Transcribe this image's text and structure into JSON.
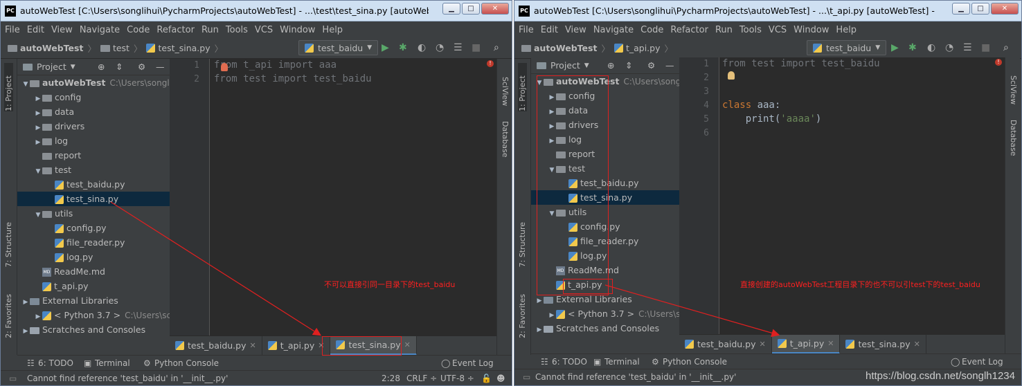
{
  "left": {
    "title": "autoWebTest [C:\\Users\\songlihui\\PycharmProjects\\autoWebTest] - ...\\test\\test_sina.py [autoWebTest] - ...",
    "menu": [
      "File",
      "Edit",
      "View",
      "Navigate",
      "Code",
      "Refactor",
      "Run",
      "Tools",
      "VCS",
      "Window",
      "Help"
    ],
    "breadcrumb": [
      "autoWebTest",
      "test",
      "test_sina.py"
    ],
    "run_config": "test_baidu",
    "project_header": "Project",
    "tree": [
      {
        "label": "autoWebTest",
        "path": "C:\\Users\\songli",
        "depth": 0,
        "arrow": "▼",
        "type": "folder",
        "bold": true
      },
      {
        "label": "config",
        "depth": 1,
        "arrow": "▶",
        "type": "folder"
      },
      {
        "label": "data",
        "depth": 1,
        "arrow": "▶",
        "type": "folder"
      },
      {
        "label": "drivers",
        "depth": 1,
        "arrow": "▶",
        "type": "folder"
      },
      {
        "label": "log",
        "depth": 1,
        "arrow": "▶",
        "type": "folder"
      },
      {
        "label": "report",
        "depth": 1,
        "arrow": "",
        "type": "folder"
      },
      {
        "label": "test",
        "depth": 1,
        "arrow": "▼",
        "type": "folder"
      },
      {
        "label": "test_baidu.py",
        "depth": 2,
        "arrow": "",
        "type": "py"
      },
      {
        "label": "test_sina.py",
        "depth": 2,
        "arrow": "",
        "type": "py",
        "selected": true
      },
      {
        "label": "utils",
        "depth": 1,
        "arrow": "▼",
        "type": "folder"
      },
      {
        "label": "config.py",
        "depth": 2,
        "arrow": "",
        "type": "py"
      },
      {
        "label": "file_reader.py",
        "depth": 2,
        "arrow": "",
        "type": "py"
      },
      {
        "label": "log.py",
        "depth": 2,
        "arrow": "",
        "type": "py"
      },
      {
        "label": "ReadMe.md",
        "depth": 1,
        "arrow": "",
        "type": "md"
      },
      {
        "label": "t_api.py",
        "depth": 1,
        "arrow": "",
        "type": "py"
      },
      {
        "label": "External Libraries",
        "depth": 0,
        "arrow": "▶",
        "type": "lib"
      },
      {
        "label": "< Python 3.7 >",
        "path": "C:\\Users\\sc",
        "depth": 1,
        "arrow": "▶",
        "type": "python"
      },
      {
        "label": "Scratches and Consoles",
        "depth": 0,
        "arrow": "▶",
        "type": "scratch"
      }
    ],
    "code_lines": [
      [
        {
          "t": "from ",
          "c": "dim"
        },
        {
          "t": "t_api ",
          "c": "dim"
        },
        {
          "t": "import ",
          "c": "dim"
        },
        {
          "t": "aaa",
          "c": "dim"
        }
      ],
      [
        {
          "t": "from ",
          "c": "dim"
        },
        {
          "t": "test ",
          "c": "dim"
        },
        {
          "t": "import ",
          "c": "dim"
        },
        {
          "t": "test_baidu",
          "c": "dim"
        }
      ]
    ],
    "line_numbers": [
      "1",
      "2"
    ],
    "tabs": [
      {
        "label": "test_baidu.py",
        "active": false
      },
      {
        "label": "t_api.py",
        "active": false
      },
      {
        "label": "test_sina.py",
        "active": true
      }
    ],
    "side_left": [
      "1: Project",
      "7: Structure",
      "2: Favorites"
    ],
    "side_right": [
      "SciView",
      "Database"
    ],
    "bottom_tools": [
      "6: TODO",
      "Terminal",
      "Python Console"
    ],
    "event_log": "Event Log",
    "status_msg": "Cannot find reference 'test_baidu' in '__init__.py'",
    "status_pos": "2:28",
    "status_crlf": "CRLF ÷",
    "status_enc": "UTF-8 ÷",
    "annotation": "不可以直接引同一目录下的test_baidu"
  },
  "right": {
    "title": "autoWebTest [C:\\Users\\songlihui\\PycharmProjects\\autoWebTest] - ...\\t_api.py [autoWebTest] - PyChar...",
    "menu": [
      "File",
      "Edit",
      "View",
      "Navigate",
      "Code",
      "Refactor",
      "Run",
      "Tools",
      "VCS",
      "Window",
      "Help"
    ],
    "breadcrumb": [
      "autoWebTest",
      "t_api.py"
    ],
    "run_config": "test_baidu",
    "project_header": "Project",
    "tree": [
      {
        "label": "autoWebTest",
        "path": "C:\\Users\\songli",
        "depth": 0,
        "arrow": "▼",
        "type": "folder",
        "bold": true
      },
      {
        "label": "config",
        "depth": 1,
        "arrow": "▶",
        "type": "folder"
      },
      {
        "label": "data",
        "depth": 1,
        "arrow": "▶",
        "type": "folder"
      },
      {
        "label": "drivers",
        "depth": 1,
        "arrow": "▶",
        "type": "folder"
      },
      {
        "label": "log",
        "depth": 1,
        "arrow": "▶",
        "type": "folder"
      },
      {
        "label": "report",
        "depth": 1,
        "arrow": "",
        "type": "folder"
      },
      {
        "label": "test",
        "depth": 1,
        "arrow": "▼",
        "type": "folder"
      },
      {
        "label": "test_baidu.py",
        "depth": 2,
        "arrow": "",
        "type": "py"
      },
      {
        "label": "test_sina.py",
        "depth": 2,
        "arrow": "",
        "type": "py",
        "selected": true
      },
      {
        "label": "utils",
        "depth": 1,
        "arrow": "▼",
        "type": "folder"
      },
      {
        "label": "config.py",
        "depth": 2,
        "arrow": "",
        "type": "py"
      },
      {
        "label": "file_reader.py",
        "depth": 2,
        "arrow": "",
        "type": "py"
      },
      {
        "label": "log.py",
        "depth": 2,
        "arrow": "",
        "type": "py"
      },
      {
        "label": "ReadMe.md",
        "depth": 1,
        "arrow": "",
        "type": "md"
      },
      {
        "label": "t_api.py",
        "depth": 1,
        "arrow": "",
        "type": "py"
      },
      {
        "label": "External Libraries",
        "depth": 0,
        "arrow": "▶",
        "type": "lib"
      },
      {
        "label": "< Python 3.7 >",
        "path": "C:\\Users\\sc",
        "depth": 1,
        "arrow": "▶",
        "type": "python"
      },
      {
        "label": "Scratches and Consoles",
        "depth": 0,
        "arrow": "▶",
        "type": "scratch"
      }
    ],
    "code_lines": [
      [
        {
          "t": "from ",
          "c": "dim"
        },
        {
          "t": "test ",
          "c": "dim"
        },
        {
          "t": "import ",
          "c": "dim"
        },
        {
          "t": "test_baidu",
          "c": "dim"
        }
      ],
      [],
      [],
      [
        {
          "t": "class ",
          "c": "kw"
        },
        {
          "t": "aaa:",
          "c": ""
        }
      ],
      [
        {
          "t": "    ",
          "c": ""
        },
        {
          "t": "print(",
          "c": ""
        },
        {
          "t": "'aaaa'",
          "c": "str"
        },
        {
          "t": ")",
          "c": ""
        }
      ],
      []
    ],
    "line_numbers": [
      "1",
      "2",
      "3",
      "4",
      "5",
      "6"
    ],
    "tabs": [
      {
        "label": "test_baidu.py",
        "active": false
      },
      {
        "label": "t_api.py",
        "active": true
      },
      {
        "label": "test_sina.py",
        "active": false
      }
    ],
    "side_left": [
      "1: Project",
      "7: Structure",
      "2: Favorites"
    ],
    "side_right": [
      "SciView",
      "Database"
    ],
    "bottom_tools": [
      "6: TODO",
      "Terminal",
      "Python Console"
    ],
    "event_log": "Event Log",
    "status_msg": "Cannot find reference 'test_baidu' in '__init__.py'",
    "annotation": "直接创建的autoWebTest工程目录下的也不可以引test下的test_baidu"
  },
  "watermark": "https://blog.csdn.net/songlh1234",
  "colors": {
    "bg": "#3c3f41",
    "editor": "#2b2b2b",
    "selection": "#0d293e",
    "annotation": "#ff2020",
    "keyword": "#cc7832",
    "string": "#6a8759"
  }
}
